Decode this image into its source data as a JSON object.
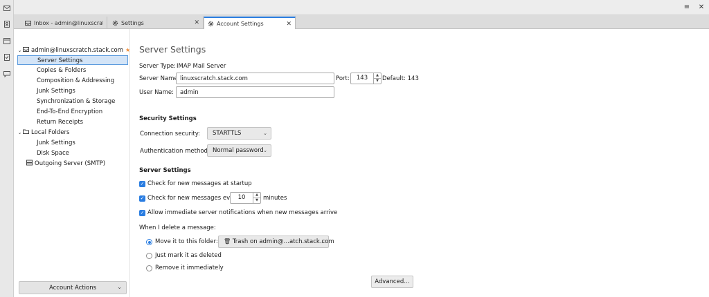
{
  "tabs": [
    {
      "label": "Inbox - admin@linuxscratch.stac"
    },
    {
      "label": "Settings"
    },
    {
      "label": "Account Settings"
    }
  ],
  "sidebar": {
    "account": "admin@linuxscratch.stack.com",
    "items": [
      "Server Settings",
      "Copies & Folders",
      "Composition & Addressing",
      "Junk Settings",
      "Synchronization & Storage",
      "End-To-End Encryption",
      "Return Receipts"
    ],
    "local_folders": "Local Folders",
    "local_items": [
      "Junk Settings",
      "Disk Space"
    ],
    "outgoing": "Outgoing Server (SMTP)",
    "account_actions": "Account Actions"
  },
  "main": {
    "title": "Server Settings",
    "server_type_label": "Server Type:",
    "server_type_value": "IMAP Mail Server",
    "server_name_label": "Server Name:",
    "server_name_value": "linuxscratch.stack.com",
    "port_label": "Port:",
    "port_value": "143",
    "default_label": "Default: 143",
    "user_name_label": "User Name:",
    "user_name_value": "admin",
    "security_heading": "Security Settings",
    "connection_security_label": "Connection security:",
    "connection_security_value": "STARTTLS",
    "auth_method_label": "Authentication method:",
    "auth_method_value": "Normal password",
    "server_heading": "Server Settings",
    "check_startup_label": "Check for new messages at startup",
    "check_every_label": "Check for new messages every",
    "check_every_value": "10",
    "minutes_label": "minutes",
    "allow_notif_label": "Allow immediate server notifications when new messages arrive",
    "delete_label": "When I delete a message:",
    "move_label": "Move it to this folder:",
    "trash_folder": "Trash on admin@…atch.stack.com",
    "mark_deleted_label": "Just mark it as deleted",
    "remove_label": "Remove it immediately",
    "advanced_label": "Advanced…"
  },
  "colors": {
    "accent": "#2a7de1",
    "selection": "#d3e4f7",
    "star": "#f08b34"
  }
}
